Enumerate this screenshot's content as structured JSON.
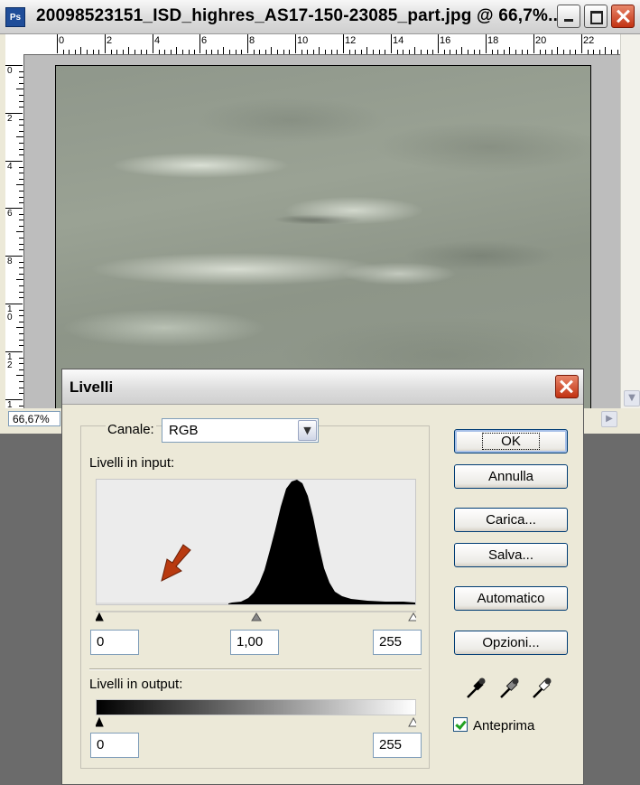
{
  "document": {
    "title": "20098523151_ISD_highres_AS17-150-23085_part.jpg @ 66,7%...",
    "app_icon": "Ps",
    "zoom": "66,67%",
    "ruler_h_labels": [
      "0",
      "2",
      "4",
      "6",
      "8",
      "10",
      "12",
      "14",
      "16",
      "18",
      "20",
      "22"
    ],
    "ruler_v_labels": [
      "0",
      "2",
      "4",
      "6",
      "8",
      "10",
      "12",
      "1"
    ]
  },
  "dialog": {
    "title": "Livelli",
    "channel_label": "Canale:",
    "channel_value": "RGB",
    "input_levels_label": "Livelli in input:",
    "input_black": "0",
    "input_gamma": "1,00",
    "input_white": "255",
    "output_levels_label": "Livelli in output:",
    "output_black": "0",
    "output_white": "255",
    "buttons": {
      "ok": "OK",
      "annulla": "Annulla",
      "carica": "Carica...",
      "salva": "Salva...",
      "automatico": "Automatico",
      "opzioni": "Opzioni..."
    },
    "preview_label": "Anteprima",
    "preview_checked": true
  },
  "colors": {
    "arrow": "#b83a10",
    "close_button": "#c23212"
  }
}
